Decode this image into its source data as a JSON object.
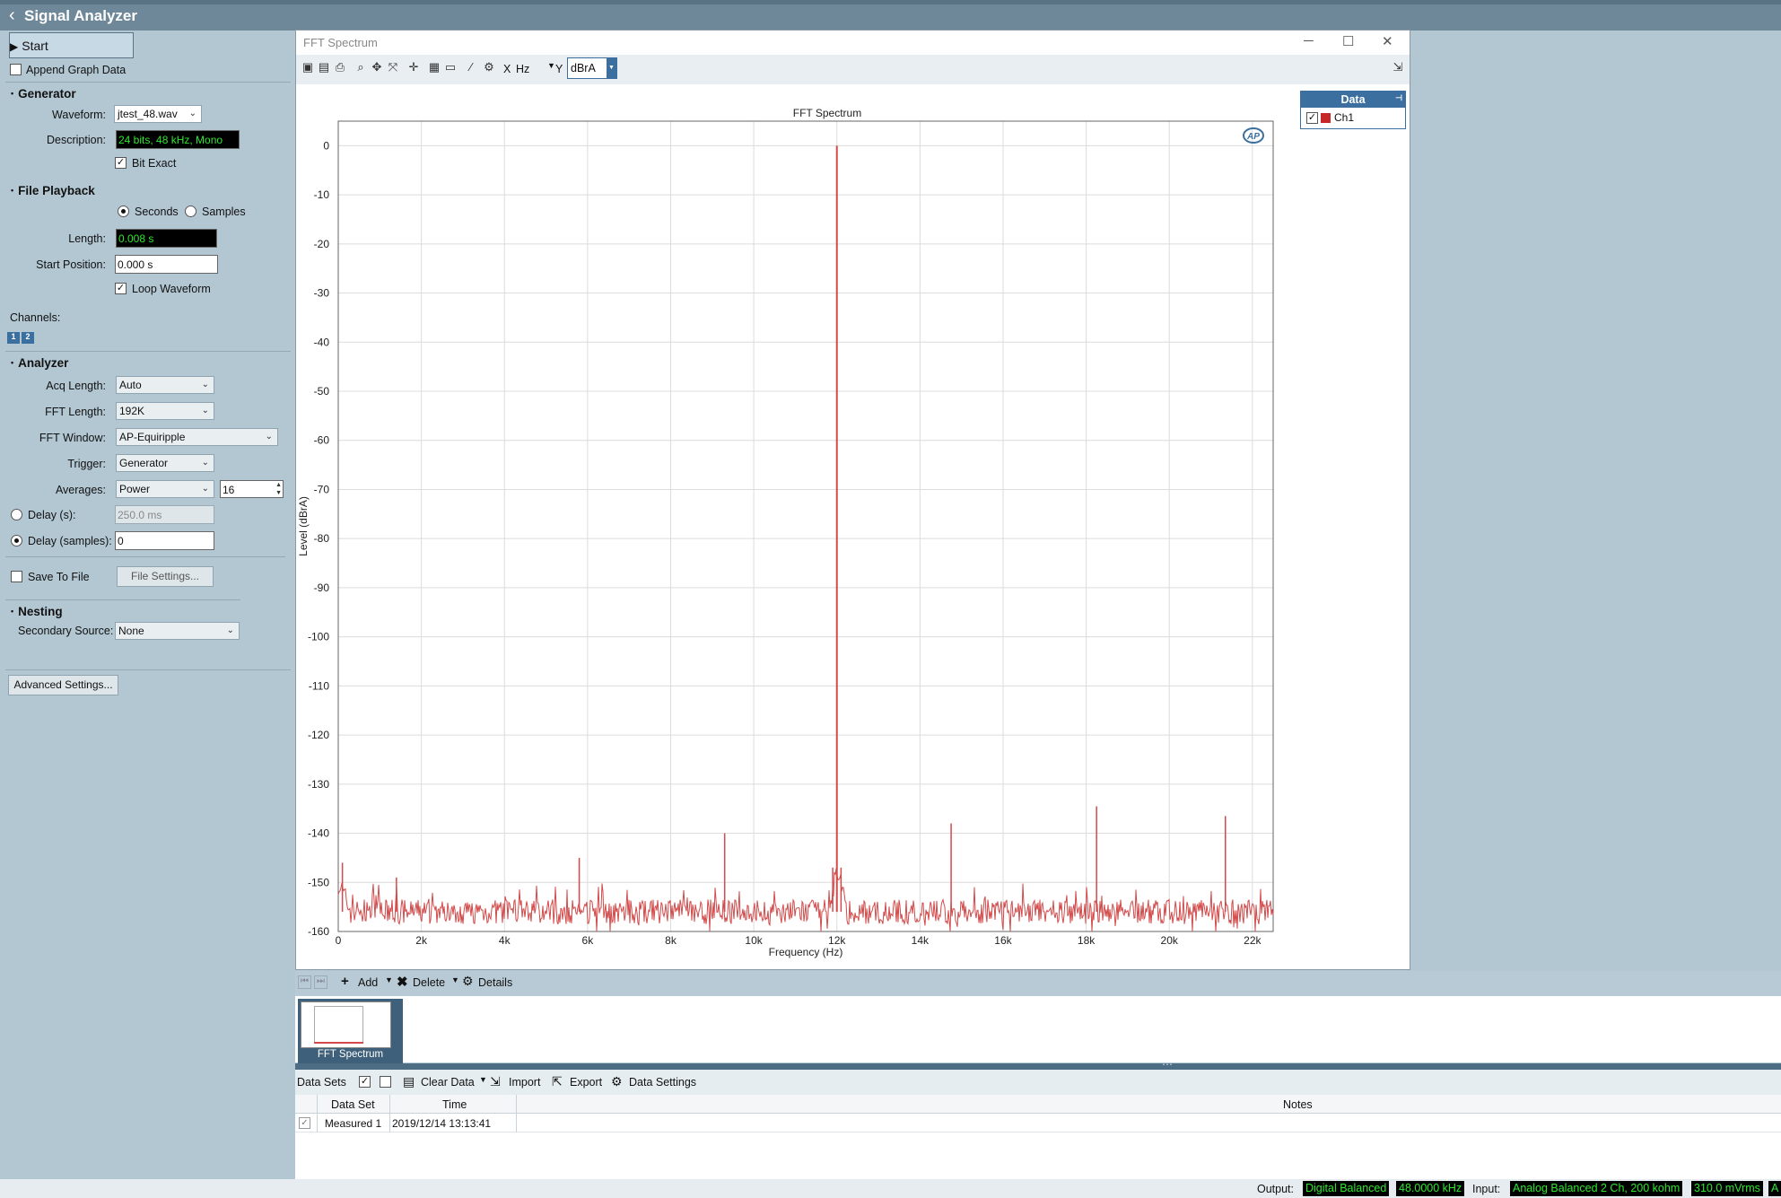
{
  "app": {
    "title": "Signal Analyzer"
  },
  "controls": {
    "start_label": "Start",
    "append_label": "Append Graph Data",
    "advanced_label": "Advanced Settings..."
  },
  "generator": {
    "section": "Generator",
    "waveform_label": "Waveform:",
    "waveform_value": "jtest_48.wav",
    "description_label": "Description:",
    "description_value": "24 bits, 48 kHz, Mono",
    "bit_exact_label": "Bit Exact",
    "bit_exact_checked": true
  },
  "playback": {
    "section": "File Playback",
    "seconds_label": "Seconds",
    "samples_label": "Samples",
    "length_label": "Length:",
    "length_value": "0.008 s",
    "start_label": "Start Position:",
    "start_value": "0.000 s",
    "loop_label": "Loop Waveform",
    "loop_checked": true
  },
  "channels": {
    "label": "Channels:",
    "icons": [
      "1",
      "2"
    ]
  },
  "analyzer": {
    "section": "Analyzer",
    "acq_label": "Acq Length:",
    "acq_value": "Auto",
    "fftlen_label": "FFT Length:",
    "fftlen_value": "192K",
    "window_label": "FFT Window:",
    "window_value": "AP-Equiripple",
    "trigger_label": "Trigger:",
    "trigger_value": "Generator",
    "avg_label": "Averages:",
    "avg_value": "Power",
    "avg_count": "16",
    "delay_s_label": "Delay (s):",
    "delay_s_value": "250.0 ms",
    "delay_samples_label": "Delay (samples):",
    "delay_samples_value": "0",
    "save_label": "Save To File",
    "file_settings_label": "File Settings..."
  },
  "nesting": {
    "section": "Nesting",
    "source_label": "Secondary Source:",
    "source_value": "None"
  },
  "graph_window": {
    "title": "FFT Spectrum",
    "x_label": "X",
    "x_unit": "Hz",
    "y_label": "Y",
    "y_unit": "dBrA",
    "legend_header": "Data",
    "legend_item": "Ch1",
    "logo": "AP"
  },
  "chart_data": {
    "type": "line",
    "title": "FFT Spectrum",
    "xlabel": "Frequency (Hz)",
    "ylabel": "Level (dBrA)",
    "xlim": [
      0,
      22500
    ],
    "ylim": [
      -160,
      5
    ],
    "x_ticks": [
      0,
      2000,
      4000,
      6000,
      8000,
      10000,
      12000,
      14000,
      16000,
      18000,
      20000,
      22000
    ],
    "x_tick_labels": [
      "0",
      "2k",
      "4k",
      "6k",
      "8k",
      "10k",
      "12k",
      "14k",
      "16k",
      "18k",
      "20k",
      "22k"
    ],
    "y_ticks": [
      0,
      -10,
      -20,
      -30,
      -40,
      -50,
      -60,
      -70,
      -80,
      -90,
      -100,
      -110,
      -120,
      -130,
      -140,
      -150,
      -160
    ],
    "y_tick_labels": [
      "0",
      "-10",
      "-20",
      "-30",
      "-40",
      "-50",
      "-60",
      "-70",
      "-80",
      "-90",
      "-100",
      "-110",
      "-120",
      "-130",
      "-140",
      "-150",
      "-160"
    ],
    "grid": true,
    "series": [
      {
        "name": "Ch1",
        "color": "#d24a4a",
        "noise_floor": -156,
        "peaks": [
          {
            "x": 12000,
            "y": 0
          },
          {
            "x": 100,
            "y": -146
          },
          {
            "x": 1400,
            "y": -149
          },
          {
            "x": 5800,
            "y": -145
          },
          {
            "x": 9300,
            "y": -140
          },
          {
            "x": 11900,
            "y": -147
          },
          {
            "x": 12100,
            "y": -147
          },
          {
            "x": 14750,
            "y": -138
          },
          {
            "x": 18250,
            "y": -134.5
          },
          {
            "x": 21350,
            "y": -136.5
          }
        ]
      }
    ]
  },
  "nav": {
    "add": "Add",
    "delete": "Delete",
    "details": "Details",
    "thumb_label": "FFT Spectrum"
  },
  "datasets": {
    "bar_label": "Data Sets",
    "clear": "Clear Data",
    "import": "Import",
    "export": "Export",
    "settings": "Data Settings",
    "columns": [
      "Data Set",
      "Time",
      "Notes"
    ],
    "rows": [
      {
        "name": "Measured 1",
        "time": "2019/12/14 13:13:41",
        "notes": ""
      }
    ]
  },
  "status": {
    "output_label": "Output:",
    "output_value": "Digital Balanced",
    "output_rate": "48.0000 kHz",
    "input_label": "Input:",
    "input_value": "Analog Balanced 2 Ch, 200 kohm",
    "input_level": "310.0 mVrms",
    "input_extra": "A"
  },
  "colors": {
    "accent": "#3b6f9f",
    "trace": "#d24a4a",
    "panel": "#b3c7d3",
    "meter_text": "#2fe62f"
  }
}
